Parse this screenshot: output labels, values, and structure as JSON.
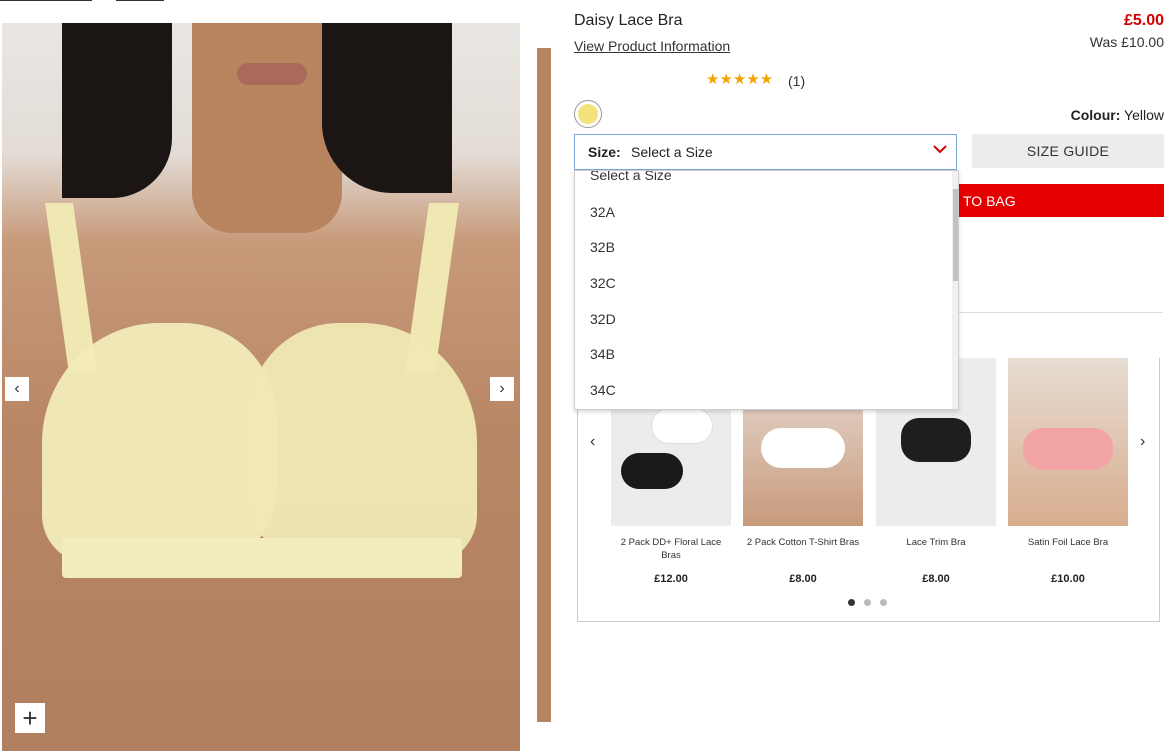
{
  "product": {
    "title": "Daisy Lace Bra",
    "view_info_link": "View Product Information",
    "price": "£5.00",
    "was_price": "Was £10.00",
    "rating_stars": "★★★★★",
    "review_count": "(1)",
    "colour_label": "Colour:",
    "colour_value": "Yellow",
    "colour_hex": "#f4e27a"
  },
  "size": {
    "label": "Size:",
    "selected": "Select a Size",
    "options": [
      "Select a Size",
      "32A",
      "32B",
      "32C",
      "32D",
      "34B",
      "34C"
    ]
  },
  "buttons": {
    "size_guide": "SIZE GUIDE",
    "add_to_bag_visible": "TO BAG",
    "gallery_prev": "‹",
    "gallery_next": "›",
    "zoom": "+"
  },
  "recommendations": {
    "items": [
      {
        "name": "2 Pack DD+ Floral Lace Bras",
        "price": "£12.00"
      },
      {
        "name": "2 Pack Cotton T-Shirt Bras",
        "price": "£8.00"
      },
      {
        "name": "Lace Trim Bra",
        "price": "£8.00"
      },
      {
        "name": "Satin Foil Lace Bra",
        "price": "£10.00"
      }
    ],
    "prev": "‹",
    "next": "›",
    "page_dots": 3,
    "active_dot": 0
  },
  "colors": {
    "accent_red": "#e50000",
    "price_red": "#d50000",
    "star_gold": "#f2a400"
  }
}
